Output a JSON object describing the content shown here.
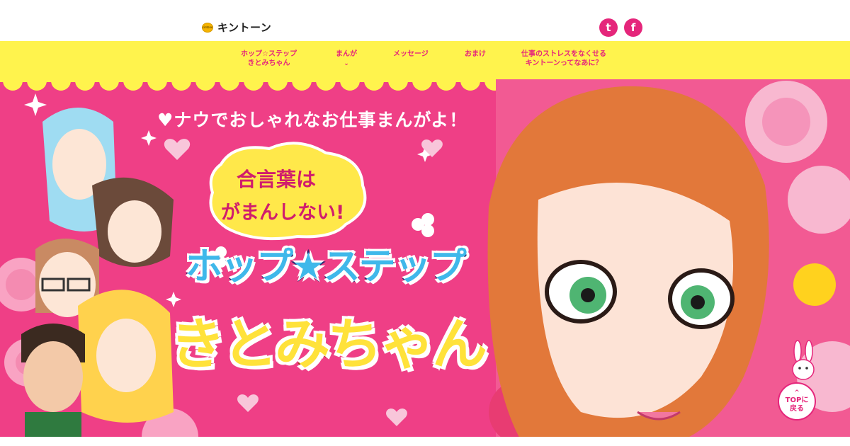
{
  "header": {
    "logo_mark": "kintone",
    "logo_text": "キントーン",
    "social": [
      {
        "icon": "twitter-icon",
        "glyph": "t"
      },
      {
        "icon": "facebook-icon",
        "glyph": "f"
      }
    ]
  },
  "nav": {
    "items": [
      {
        "line1": "ホップ☆ステップ",
        "line2": "きとみちゃん"
      },
      {
        "line1": "まんが",
        "chevron": "⌄"
      },
      {
        "line1": "メッセージ"
      },
      {
        "line1": "おまけ"
      },
      {
        "line1": "仕事のストレスをなくせる",
        "line2": "キントーンってなあに？"
      }
    ]
  },
  "hero": {
    "catchphrase": "♥ナウでおしゃれなお仕事まんがよ！",
    "bubble_line1": "合言葉は",
    "bubble_line2": "がまんしない!",
    "title_line1": "ホップ★ステップ",
    "title_line2": "きとみちゃん"
  },
  "top_button": {
    "arrow": "^",
    "line1": "TOPに",
    "line2": "戻る"
  },
  "colors": {
    "brand_pink": "#e5267b",
    "hero_pink": "#ef3f86",
    "nav_yellow": "#fff34d",
    "title_blue": "#3fb8ea",
    "title_yellow": "#ffe23a"
  }
}
